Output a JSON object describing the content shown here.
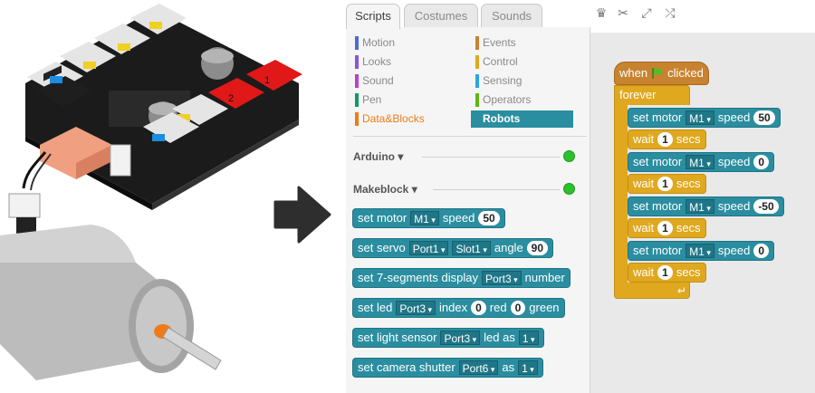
{
  "tabs": [
    {
      "label": "Scripts",
      "active": true
    },
    {
      "label": "Costumes",
      "active": false
    },
    {
      "label": "Sounds",
      "active": false
    }
  ],
  "toolbar_icons": [
    "stamp-icon",
    "scissors-icon",
    "grow-icon",
    "shrink-icon"
  ],
  "categories": [
    {
      "label": "Motion",
      "color": "#4a6cd4"
    },
    {
      "label": "Events",
      "color": "#c88330"
    },
    {
      "label": "Looks",
      "color": "#8a55d7"
    },
    {
      "label": "Control",
      "color": "#e1a91a"
    },
    {
      "label": "Sound",
      "color": "#bb42c3"
    },
    {
      "label": "Sensing",
      "color": "#2ca5e2"
    },
    {
      "label": "Pen",
      "color": "#0e9a6c"
    },
    {
      "label": "Operators",
      "color": "#5cb712"
    },
    {
      "label": "Data&Blocks",
      "color": "#ee7d16"
    },
    {
      "label": "Robots",
      "color": "#2a8ea0"
    }
  ],
  "extensions": [
    {
      "label": "Arduino",
      "status_color": "#2cc02c"
    },
    {
      "label": "Makeblock",
      "status_color": "#2cc02c"
    }
  ],
  "palette_blocks": {
    "motor": {
      "text1": "set motor",
      "port": "M1",
      "text2": "speed",
      "value": "50"
    },
    "servo": {
      "text1": "set servo",
      "port": "Port1",
      "slot": "Slot1",
      "text2": "angle",
      "value": "90"
    },
    "seg": {
      "text1": "set 7-segments display",
      "port": "Port3",
      "text2": "number"
    },
    "led": {
      "text1": "set led",
      "port": "Port3",
      "text2": "index",
      "v1": "0",
      "text3": "red",
      "v2": "0",
      "text4": "green"
    },
    "light": {
      "text1": "set light sensor",
      "port": "Port3",
      "text2": "led as",
      "value": "1"
    },
    "camera": {
      "text1": "set camera shutter",
      "port": "Port6",
      "text2": "as",
      "value": "1"
    }
  },
  "script": {
    "hat_when": "when",
    "hat_clicked": "clicked",
    "forever": "forever",
    "set_motor": "set motor",
    "speed": "speed",
    "port": "M1",
    "wait": "wait",
    "secs": "secs",
    "speeds": [
      "50",
      "0",
      "-50",
      "0"
    ],
    "waits": [
      "1",
      "1",
      "1",
      "1"
    ]
  }
}
